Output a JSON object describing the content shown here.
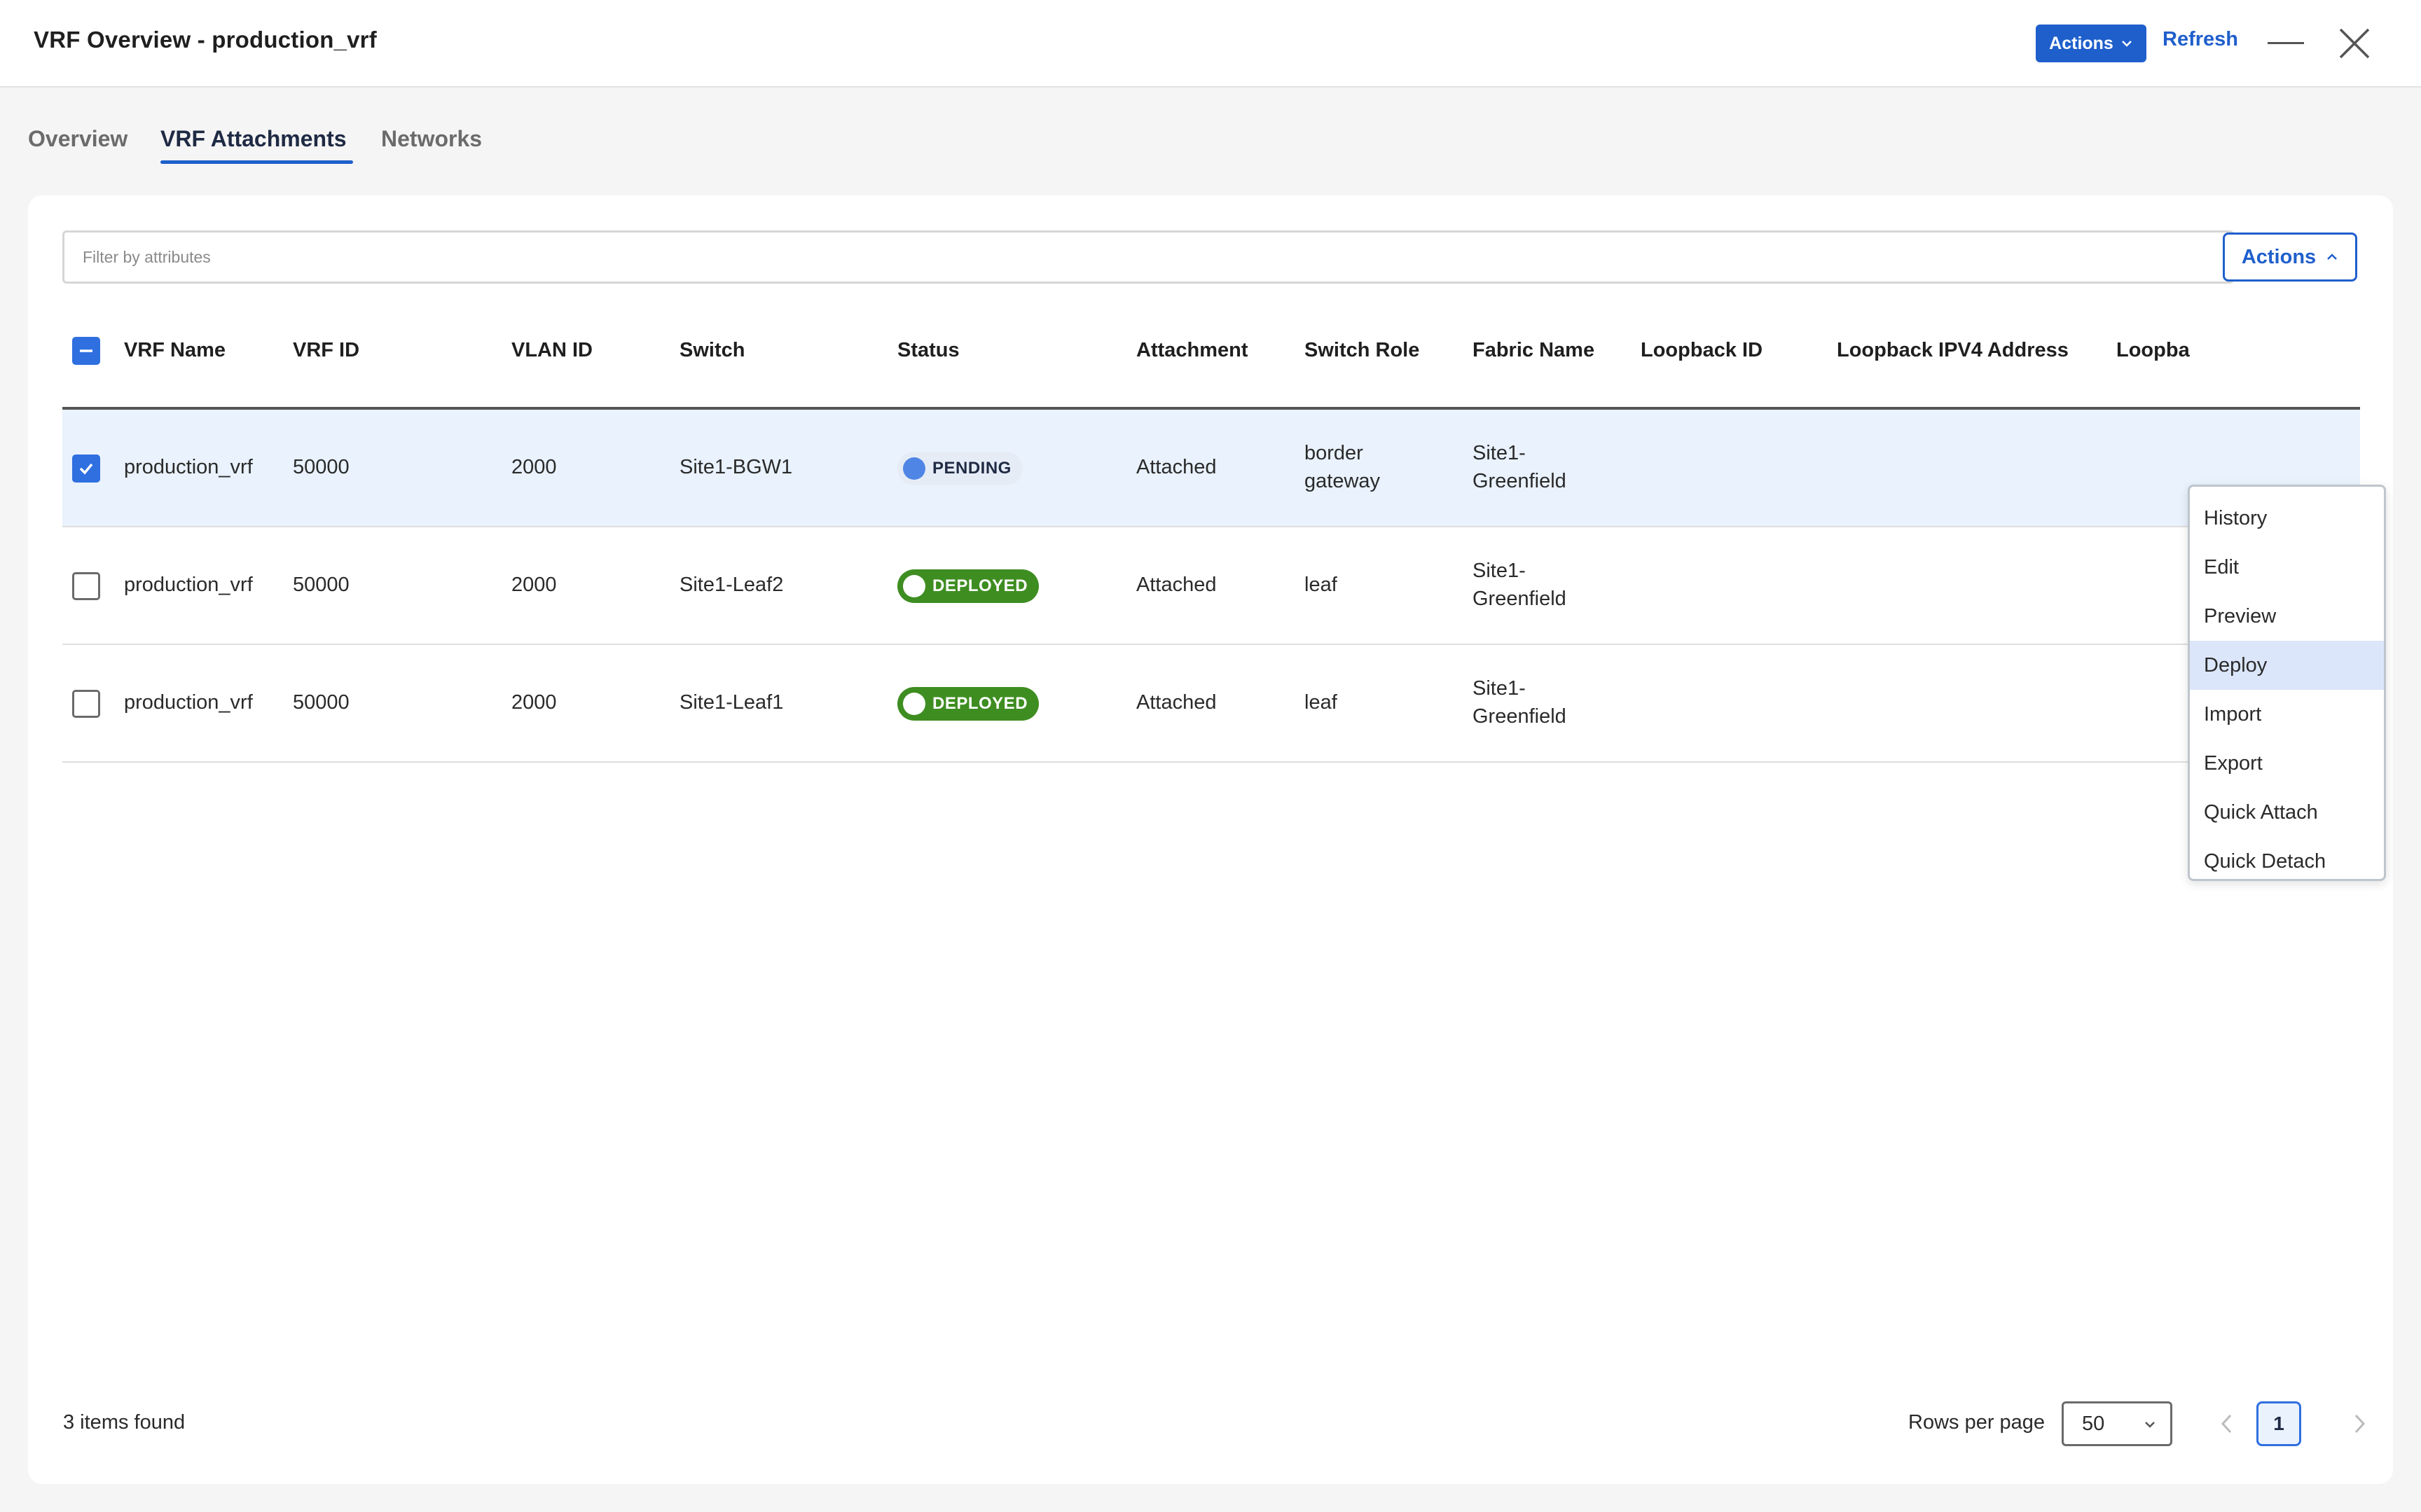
{
  "header": {
    "title": "VRF Overview - production_vrf",
    "actions_label": "Actions",
    "refresh_label": "Refresh"
  },
  "tabs": [
    {
      "label": "Overview",
      "active": false
    },
    {
      "label": "VRF Attachments",
      "active": true
    },
    {
      "label": "Networks",
      "active": false
    }
  ],
  "filter": {
    "placeholder": "Filter by attributes",
    "value": ""
  },
  "table_actions": {
    "label": "Actions",
    "expanded": true
  },
  "columns": [
    "VRF Name",
    "VRF ID",
    "VLAN ID",
    "Switch",
    "Status",
    "Attachment",
    "Switch Role",
    "Fabric Name",
    "Loopback ID",
    "Loopback IPV4 Address",
    "Loopba"
  ],
  "rows": [
    {
      "checked": true,
      "vrf_name": "production_vrf",
      "vrf_id": "50000",
      "vlan_id": "2000",
      "switch": "Site1-BGW1",
      "status": "PENDING",
      "attachment": "Attached",
      "switch_role_line1": "border",
      "switch_role_line2": "gateway",
      "fabric_line1": "Site1-",
      "fabric_line2": "Greenfield"
    },
    {
      "checked": false,
      "vrf_name": "production_vrf",
      "vrf_id": "50000",
      "vlan_id": "2000",
      "switch": "Site1-Leaf2",
      "status": "DEPLOYED",
      "attachment": "Attached",
      "switch_role_line1": "leaf",
      "switch_role_line2": "",
      "fabric_line1": "Site1-",
      "fabric_line2": "Greenfield"
    },
    {
      "checked": false,
      "vrf_name": "production_vrf",
      "vrf_id": "50000",
      "vlan_id": "2000",
      "switch": "Site1-Leaf1",
      "status": "DEPLOYED",
      "attachment": "Attached",
      "switch_role_line1": "leaf",
      "switch_role_line2": "",
      "fabric_line1": "Site1-",
      "fabric_line2": "Greenfield"
    }
  ],
  "menu": {
    "items": [
      "History",
      "Edit",
      "Preview",
      "Deploy",
      "Import",
      "Export",
      "Quick Attach",
      "Quick Detach"
    ],
    "highlighted": "Deploy"
  },
  "footer": {
    "items_found": "3 items found",
    "rows_per_page_label": "Rows per page",
    "rows_per_page_value": "50",
    "current_page": "1"
  },
  "colors": {
    "primary": "#1f5fcc",
    "deployed": "#3e8d21",
    "pending_dot": "#4f86e6",
    "selected_row": "#e9f2fd"
  }
}
